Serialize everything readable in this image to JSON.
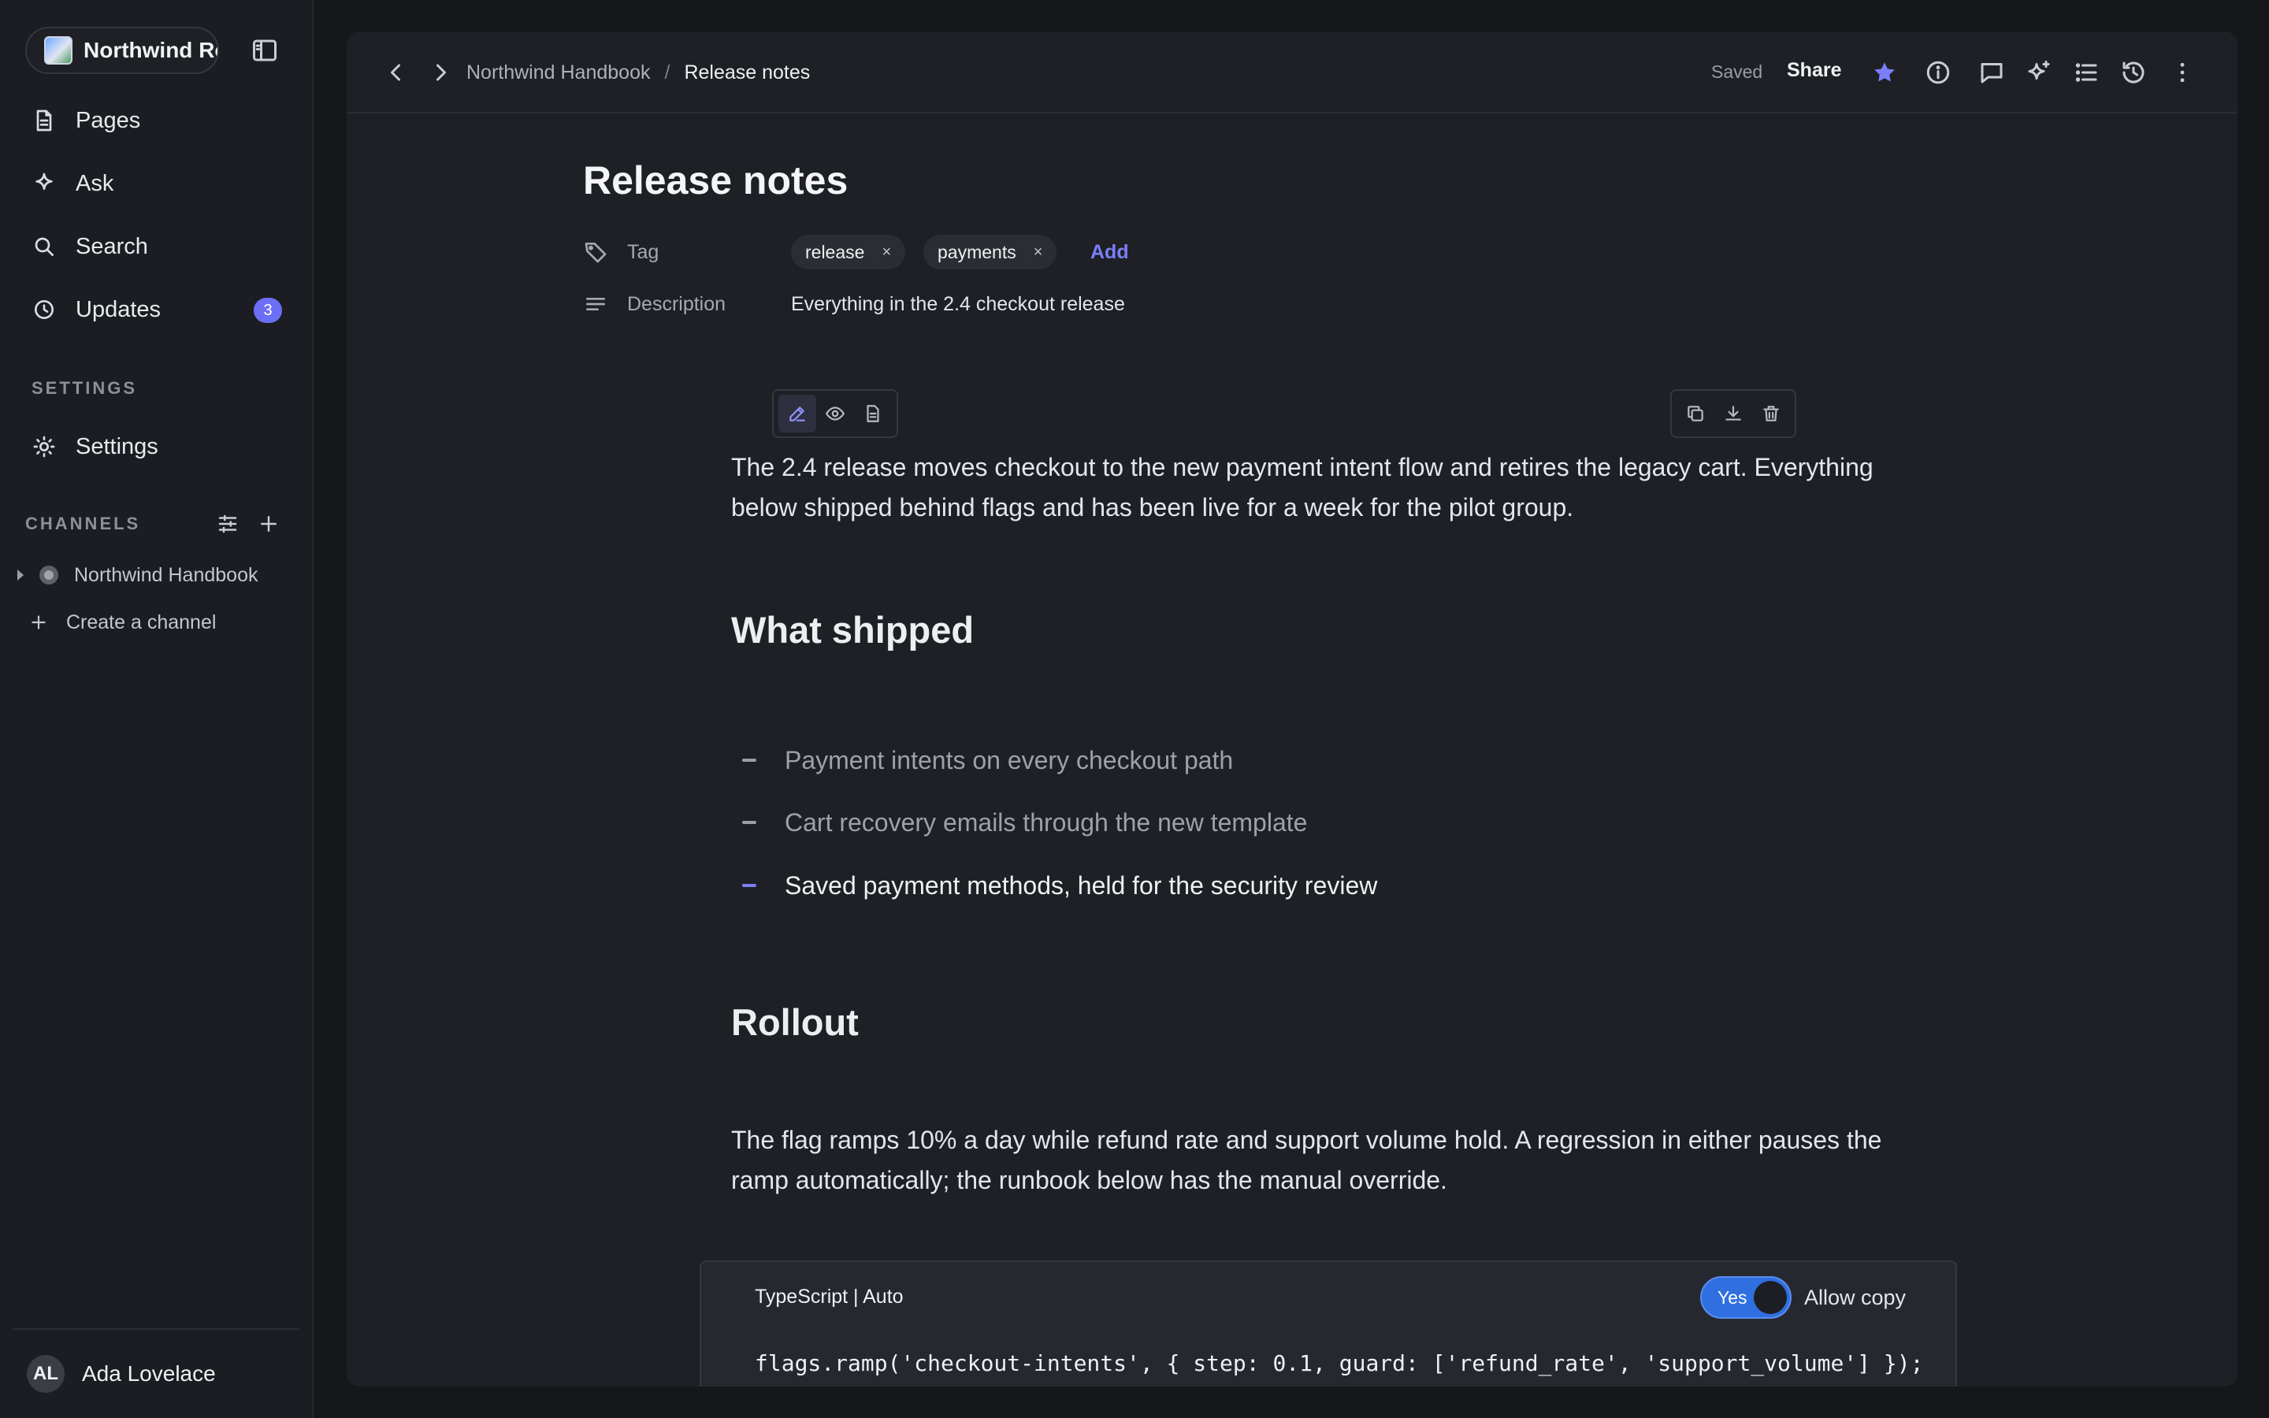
{
  "sidebar": {
    "workspace_name": "Northwind Review",
    "nav": [
      {
        "label": "Pages",
        "icon": "document-icon"
      },
      {
        "label": "Ask",
        "icon": "sparkle-icon"
      },
      {
        "label": "Search",
        "icon": "search-icon"
      },
      {
        "label": "Updates",
        "icon": "clock-icon",
        "badge": "3"
      }
    ],
    "settings_section": "SETTINGS",
    "settings_label": "Settings",
    "channels_section": "CHANNELS",
    "channels": [
      {
        "label": "Northwind Handbook"
      }
    ],
    "create_channel": "Create a channel",
    "user": {
      "initials": "AL",
      "name": "Ada Lovelace"
    }
  },
  "topbar": {
    "breadcrumb_parent": "Northwind Handbook",
    "breadcrumb_sep": "/",
    "breadcrumb_current": "Release notes",
    "saved": "Saved",
    "share": "Share"
  },
  "doc": {
    "title": "Release notes",
    "tag_label": "Tag",
    "tags": [
      "release",
      "payments"
    ],
    "tag_remove": "×",
    "add_label": "Add",
    "description_label": "Description",
    "description_value": "Everything in the 2.4 checkout release",
    "intro": "The 2.4 release moves checkout to the new payment intent flow and retires the legacy cart. Everything below shipped behind flags and has been live for a week for the pilot group.",
    "h_shipped": "What shipped",
    "bullets": [
      "Payment intents on every checkout path",
      "Cart recovery emails through the new template",
      "Saved payment methods, held for the security review"
    ],
    "h_rollout": "Rollout",
    "rollout": "The flag ramps 10% a day while refund rate and support volume hold. A regression in either pauses the ramp automatically; the runbook below has the manual override.",
    "code": {
      "lang": "TypeScript | Auto",
      "toggle": "Yes",
      "allow_copy": "Allow copy",
      "line": "flags.ramp('checkout-intents', { step: 0.1, guard: ['refund_rate', 'support_volume'] });"
    }
  },
  "colors": {
    "accent": "#7b7ff7",
    "background": "#15171b",
    "panel": "#1e2025",
    "toggle": "#2f6fe0"
  }
}
